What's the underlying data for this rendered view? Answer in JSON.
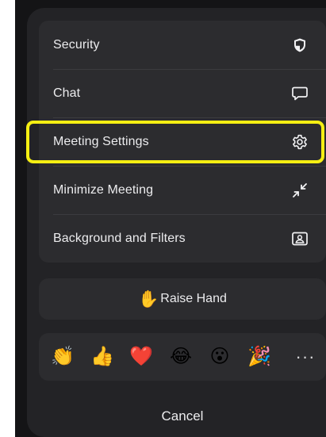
{
  "menu": {
    "items": [
      {
        "label": "Security",
        "icon": "shield-icon"
      },
      {
        "label": "Chat",
        "icon": "chat-bubble-icon"
      },
      {
        "label": "Meeting Settings",
        "icon": "gear-icon",
        "highlighted": true
      },
      {
        "label": "Minimize Meeting",
        "icon": "minimize-arrows-icon"
      },
      {
        "label": "Background and Filters",
        "icon": "background-portrait-icon"
      }
    ]
  },
  "raise_hand": {
    "label": "Raise Hand",
    "icon": "raised-hand-icon",
    "emoji": "✋"
  },
  "reactions": {
    "items": [
      {
        "name": "clapping-hands",
        "emoji": "👏"
      },
      {
        "name": "thumbs-up",
        "emoji": "👍"
      },
      {
        "name": "red-heart",
        "emoji": "❤️"
      },
      {
        "name": "tears-of-joy",
        "emoji": "😂"
      },
      {
        "name": "open-mouth",
        "emoji": "😮"
      },
      {
        "name": "party-popper",
        "emoji": "🎉"
      }
    ],
    "more_label": "···"
  },
  "cancel": {
    "label": "Cancel"
  },
  "colors": {
    "background": "#141416",
    "panel": "#232326",
    "card": "#2c2c2f",
    "text": "#ececee",
    "highlight": "#f6ef13",
    "heart": "#e8202e"
  }
}
